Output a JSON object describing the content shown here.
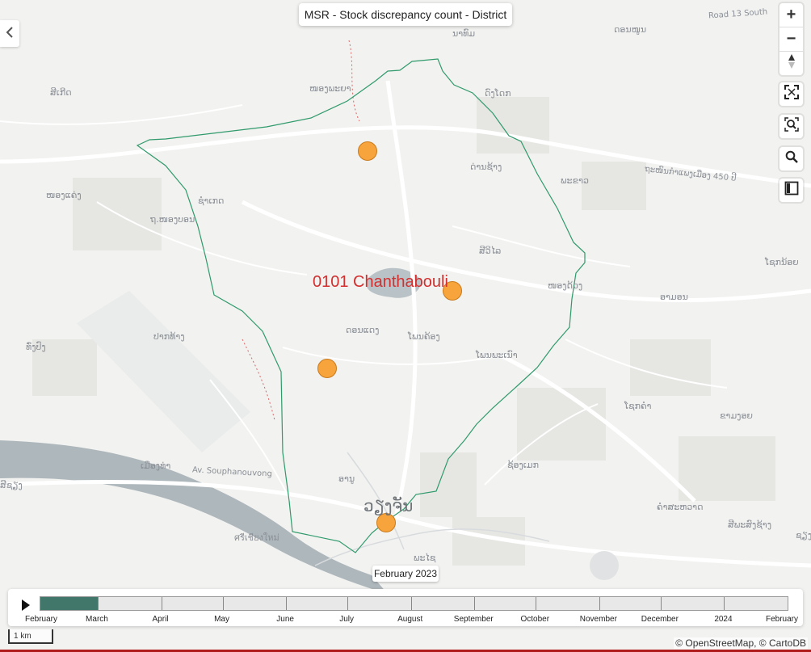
{
  "map_title": "MSR - Stock discrepancy count - District",
  "district_name": "0101 Chanthabouli",
  "controls": {
    "zoom_in": "+",
    "zoom_out": "−"
  },
  "basemap_labels": [
    {
      "text": "Road 13 South"
    },
    {
      "text": "ນາທົມ"
    },
    {
      "text": "ດອນໜູນ"
    },
    {
      "text": "ສີເກີດ"
    },
    {
      "text": "ໜອງພະຍາ"
    },
    {
      "text": "ດົງໂດກ"
    },
    {
      "text": "ດ່ານຊ້າງ"
    },
    {
      "text": "ພະຂາວ"
    },
    {
      "text": "ໜອງແຄ່ງ"
    },
    {
      "text": "ຊຳເກດ"
    },
    {
      "text": "ຖ.ໜອງບອນ"
    },
    {
      "text": "ສີວິໄລ"
    },
    {
      "text": "ໂຊກນ້ອຍ"
    },
    {
      "text": "ໜອງດ້ວງ"
    },
    {
      "text": "ອາມອນ"
    },
    {
      "text": "ທົ່ງປົງ"
    },
    {
      "text": "ປາກທ້າງ"
    },
    {
      "text": "ດອນແດງ"
    },
    {
      "text": "ໂພນຄ້ອງ"
    },
    {
      "text": "ໂພນພະເນົາ"
    },
    {
      "text": "ໂຊກຄຳ"
    },
    {
      "text": "ຂາມງອຍ"
    },
    {
      "text": "ເມືອງທ່າ"
    },
    {
      "text": "Av. Souphanouvong"
    },
    {
      "text": "ຊ້ອງເມກ"
    },
    {
      "text": "ອານູ"
    },
    {
      "text": "ວຽງຈັນ"
    },
    {
      "text": "ຄຳສະຫວາດ"
    },
    {
      "text": "ສີພະສົງຊ້າງ"
    },
    {
      "text": "ศรีเชียงใหม่"
    },
    {
      "text": "ພະໄຊ"
    },
    {
      "text": "ສີຊຽງ"
    },
    {
      "text": "ຊຽງ"
    },
    {
      "text": "ຖະໜົນກຳແພງເມືອງ 450 ປີ"
    }
  ],
  "markers": [
    {
      "name": "marker-1",
      "lon_note": "NW"
    },
    {
      "name": "marker-2",
      "lon_note": "E"
    },
    {
      "name": "marker-3",
      "lon_note": "SW"
    },
    {
      "name": "marker-4",
      "lon_note": "S"
    }
  ],
  "marker_color": "#f7a43d",
  "boundary_color": "#2f9a6b",
  "timeline": {
    "current_label": "February 2023",
    "progress_fraction": 0.077,
    "months": [
      "February",
      "March",
      "April",
      "May",
      "June",
      "July",
      "August",
      "September",
      "October",
      "November",
      "December",
      "2024",
      "February"
    ],
    "fill_color": "#41766a"
  },
  "scale_label": "1 km",
  "attribution": "© OpenStreetMap, © CartoDB"
}
